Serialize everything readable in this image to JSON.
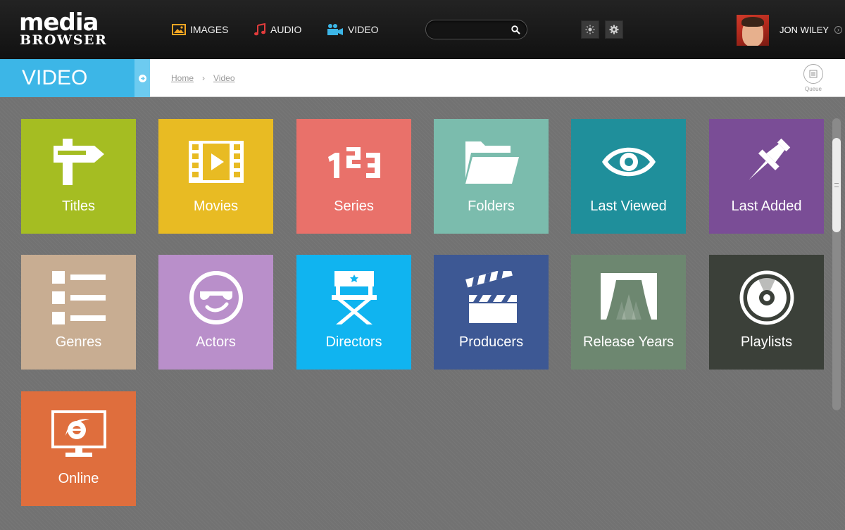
{
  "app": {
    "logo_line1": "media",
    "logo_line2": "BROWSER"
  },
  "nav": {
    "images": {
      "label": "IMAGES",
      "icon": "image-icon",
      "color": "#f3a522"
    },
    "audio": {
      "label": "AUDIO",
      "icon": "music-note-icon",
      "color": "#e23c3c"
    },
    "video": {
      "label": "VIDEO",
      "icon": "video-camera-icon",
      "color": "#3cb6e7"
    }
  },
  "search": {
    "value": "",
    "placeholder": ""
  },
  "user": {
    "name": "JON WILEY"
  },
  "section": {
    "title": "VIDEO",
    "color": "#3cb6e7"
  },
  "breadcrumb": {
    "items": [
      "Home",
      "Video"
    ],
    "separator": "›"
  },
  "queue": {
    "label": "Queue"
  },
  "tiles": [
    {
      "label": "Titles",
      "icon": "signpost-icon",
      "color": "#a5bd22"
    },
    {
      "label": "Movies",
      "icon": "film-icon",
      "color": "#e8bb23"
    },
    {
      "label": "Series",
      "icon": "numbers-icon",
      "color": "#e9716a"
    },
    {
      "label": "Folders",
      "icon": "folder-icon",
      "color": "#7bbcad"
    },
    {
      "label": "Last Viewed",
      "icon": "eye-icon",
      "color": "#1f8f9b"
    },
    {
      "label": "Last Added",
      "icon": "pushpin-icon",
      "color": "#7a4d96"
    },
    {
      "label": "Genres",
      "icon": "list-icon",
      "color": "#c8ad92"
    },
    {
      "label": "Actors",
      "icon": "smiley-sunglasses-icon",
      "color": "#b98fca"
    },
    {
      "label": "Directors",
      "icon": "directors-chair-icon",
      "color": "#10b4f0"
    },
    {
      "label": "Producers",
      "icon": "clapperboard-icon",
      "color": "#3d5894"
    },
    {
      "label": "Release Years",
      "icon": "theater-curtain-icon",
      "color": "#6d8770"
    },
    {
      "label": "Playlists",
      "icon": "disc-icon",
      "color": "#3b4039"
    },
    {
      "label": "Online",
      "icon": "monitor-browser-icon",
      "color": "#df6e3d"
    }
  ]
}
